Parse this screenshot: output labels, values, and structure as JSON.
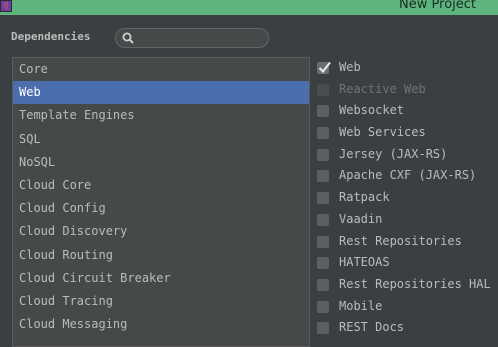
{
  "window": {
    "title": "New Project"
  },
  "dependencies_label": "Dependencies",
  "search": {
    "value": "",
    "placeholder": ""
  },
  "categories": [
    {
      "label": "Core"
    },
    {
      "label": "Web",
      "selected": true
    },
    {
      "label": "Template Engines"
    },
    {
      "label": "SQL"
    },
    {
      "label": "NoSQL"
    },
    {
      "label": "Cloud Core"
    },
    {
      "label": "Cloud Config"
    },
    {
      "label": "Cloud Discovery"
    },
    {
      "label": "Cloud Routing"
    },
    {
      "label": "Cloud Circuit Breaker"
    },
    {
      "label": "Cloud Tracing"
    },
    {
      "label": "Cloud Messaging"
    }
  ],
  "web_dependencies": [
    {
      "label": "Web",
      "checked": true,
      "enabled": true
    },
    {
      "label": "Reactive Web",
      "checked": false,
      "enabled": false
    },
    {
      "label": "Websocket",
      "checked": false,
      "enabled": true
    },
    {
      "label": "Web Services",
      "checked": false,
      "enabled": true
    },
    {
      "label": "Jersey (JAX-RS)",
      "checked": false,
      "enabled": true
    },
    {
      "label": "Apache CXF (JAX-RS)",
      "checked": false,
      "enabled": true
    },
    {
      "label": "Ratpack",
      "checked": false,
      "enabled": true
    },
    {
      "label": "Vaadin",
      "checked": false,
      "enabled": true
    },
    {
      "label": "Rest Repositories",
      "checked": false,
      "enabled": true
    },
    {
      "label": "HATEOAS",
      "checked": false,
      "enabled": true
    },
    {
      "label": "Rest Repositories HAL",
      "checked": false,
      "enabled": true
    },
    {
      "label": "Mobile",
      "checked": false,
      "enabled": true
    },
    {
      "label": "REST Docs",
      "checked": false,
      "enabled": true
    }
  ],
  "colors": {
    "title_bar": "#5db47e",
    "background": "#3c3f41",
    "selection": "#4b6eaf",
    "text": "#bbbbbb",
    "disabled_text": "#727272"
  },
  "icons": {
    "app": "intellij-app-icon",
    "search": "search-icon",
    "check": "checkmark-icon"
  }
}
